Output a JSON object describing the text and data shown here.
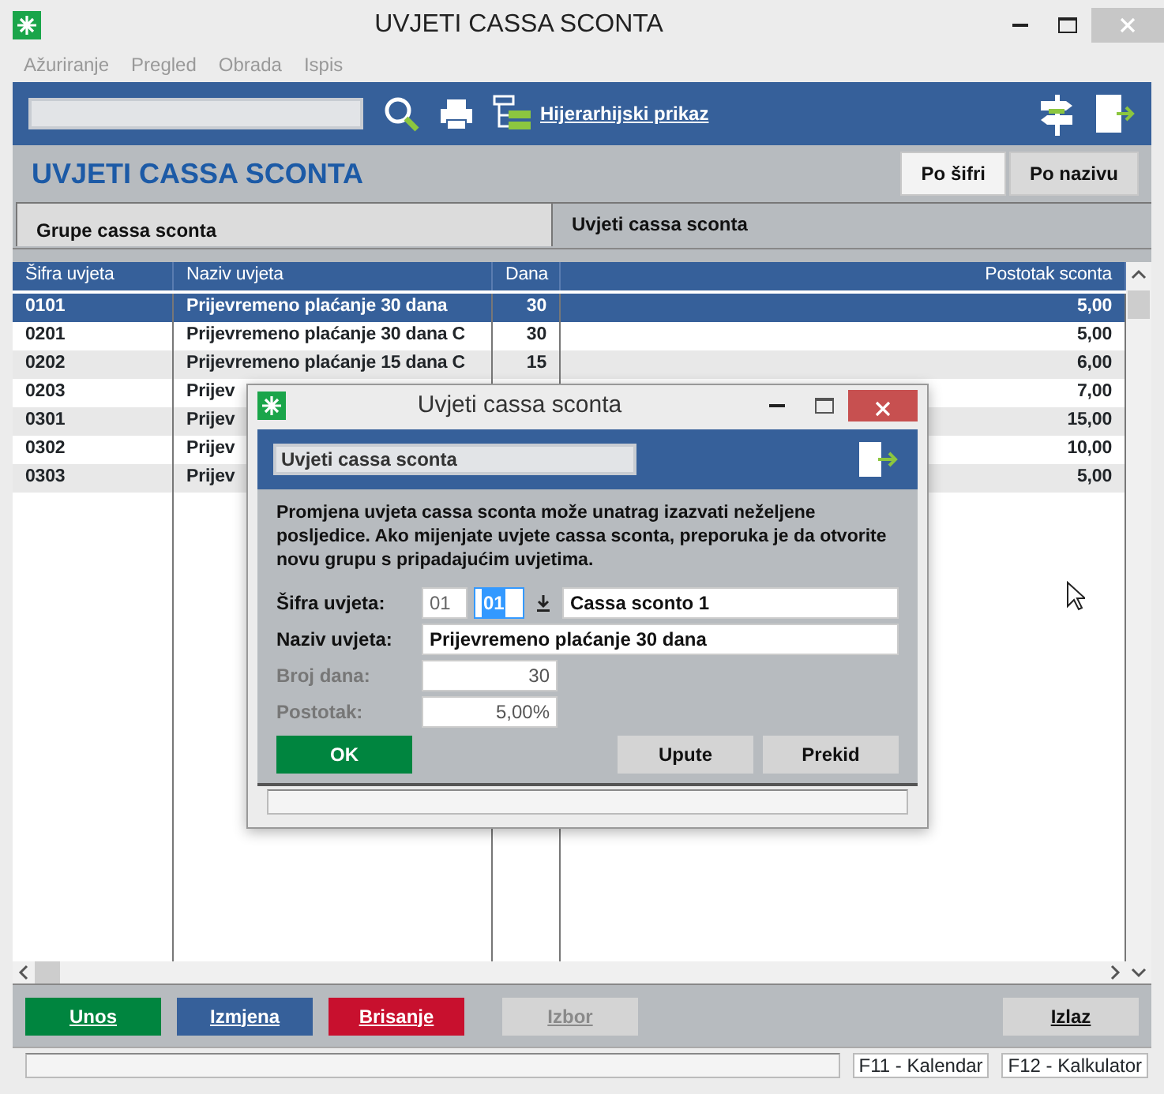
{
  "window": {
    "title": "UVJETI CASSA SCONTA"
  },
  "menu": [
    {
      "label": "Ažuriranje",
      "disabled": true
    },
    {
      "label": "Pregled",
      "disabled": true
    },
    {
      "label": "Obrada",
      "disabled": true
    },
    {
      "label": "Ispis",
      "disabled": true
    }
  ],
  "toolbar": {
    "hierarchy_button": "Hijerarhijski prikaz"
  },
  "header": {
    "title": "UVJETI CASSA SCONTA",
    "sort_buttons": [
      {
        "label": "Po šifri",
        "selected": true
      },
      {
        "label": "Po nazivu",
        "selected": false
      }
    ]
  },
  "tabs": [
    {
      "label": "Grupe cassa sconta",
      "selected": false
    },
    {
      "label": "Uvjeti cassa sconta",
      "selected": true
    }
  ],
  "table": {
    "columns": [
      "Šifra uvjeta",
      "Naziv uvjeta",
      "Dana",
      "Postotak sconta"
    ],
    "rows": [
      {
        "code": "0101",
        "name": "Prijevremeno plaćanje 30 dana",
        "days": "30",
        "percent": "5,00",
        "selected": true
      },
      {
        "code": "0201",
        "name": "Prijevremeno plaćanje 30 dana C",
        "days": "30",
        "percent": "5,00",
        "selected": false
      },
      {
        "code": "0202",
        "name": "Prijevremeno plaćanje 15 dana C",
        "days": "15",
        "percent": "6,00",
        "selected": false
      },
      {
        "code": "0203",
        "name": "Prijev",
        "percent": "7,00",
        "selected": false
      },
      {
        "code": "0301",
        "name": "Prijev",
        "percent": "15,00",
        "selected": false
      },
      {
        "code": "0302",
        "name": "Prijev",
        "percent": "10,00",
        "selected": false
      },
      {
        "code": "0303",
        "name": "Prijev",
        "percent": "5,00",
        "selected": false
      }
    ]
  },
  "buttons": [
    {
      "label": "Unos",
      "color": "#00853f",
      "disabled": false
    },
    {
      "label": "Izmjena",
      "color": "#36609a",
      "disabled": false
    },
    {
      "label": "Brisanje",
      "color": "#c8102e",
      "disabled": false
    },
    {
      "label": "Izbor",
      "color": "#d4d4d4",
      "disabled": true
    },
    {
      "label": "Izlaz",
      "color": "#d4d4d4",
      "disabled": false
    }
  ],
  "status_bar": {
    "keys": [
      "F11 - Kalendar",
      "F12 - Kalkulator"
    ]
  },
  "dialog": {
    "title": "Uvjeti cassa sconta",
    "header_field": "Uvjeti cassa sconta",
    "message": "Promjena uvjeta cassa sconta može unatrag izazvati neželjene posljedice. Ako mijenjate uvjete cassa sconta, preporuka je da otvorite novu grupu s pripadajućim uvjetima.",
    "fields": [
      {
        "label": "Šifra uvjeta:",
        "kind": "code",
        "disabled": false,
        "group": "01",
        "code": "01",
        "code_highlighted": true,
        "name": "Cassa sconto 1"
      },
      {
        "label": "Naziv uvjeta:",
        "kind": "text",
        "disabled": false,
        "value": "Prijevremeno plaćanje 30 dana"
      },
      {
        "label": "Broj dana:",
        "kind": "number",
        "disabled": true,
        "value": "30"
      },
      {
        "label": "Postotak:",
        "kind": "number",
        "disabled": true,
        "value": "5,00%"
      }
    ],
    "buttons": [
      {
        "label": "OK",
        "kind": "primary"
      },
      {
        "label": "Upute",
        "kind": "plain"
      },
      {
        "label": "Prekid",
        "kind": "plain"
      }
    ]
  }
}
